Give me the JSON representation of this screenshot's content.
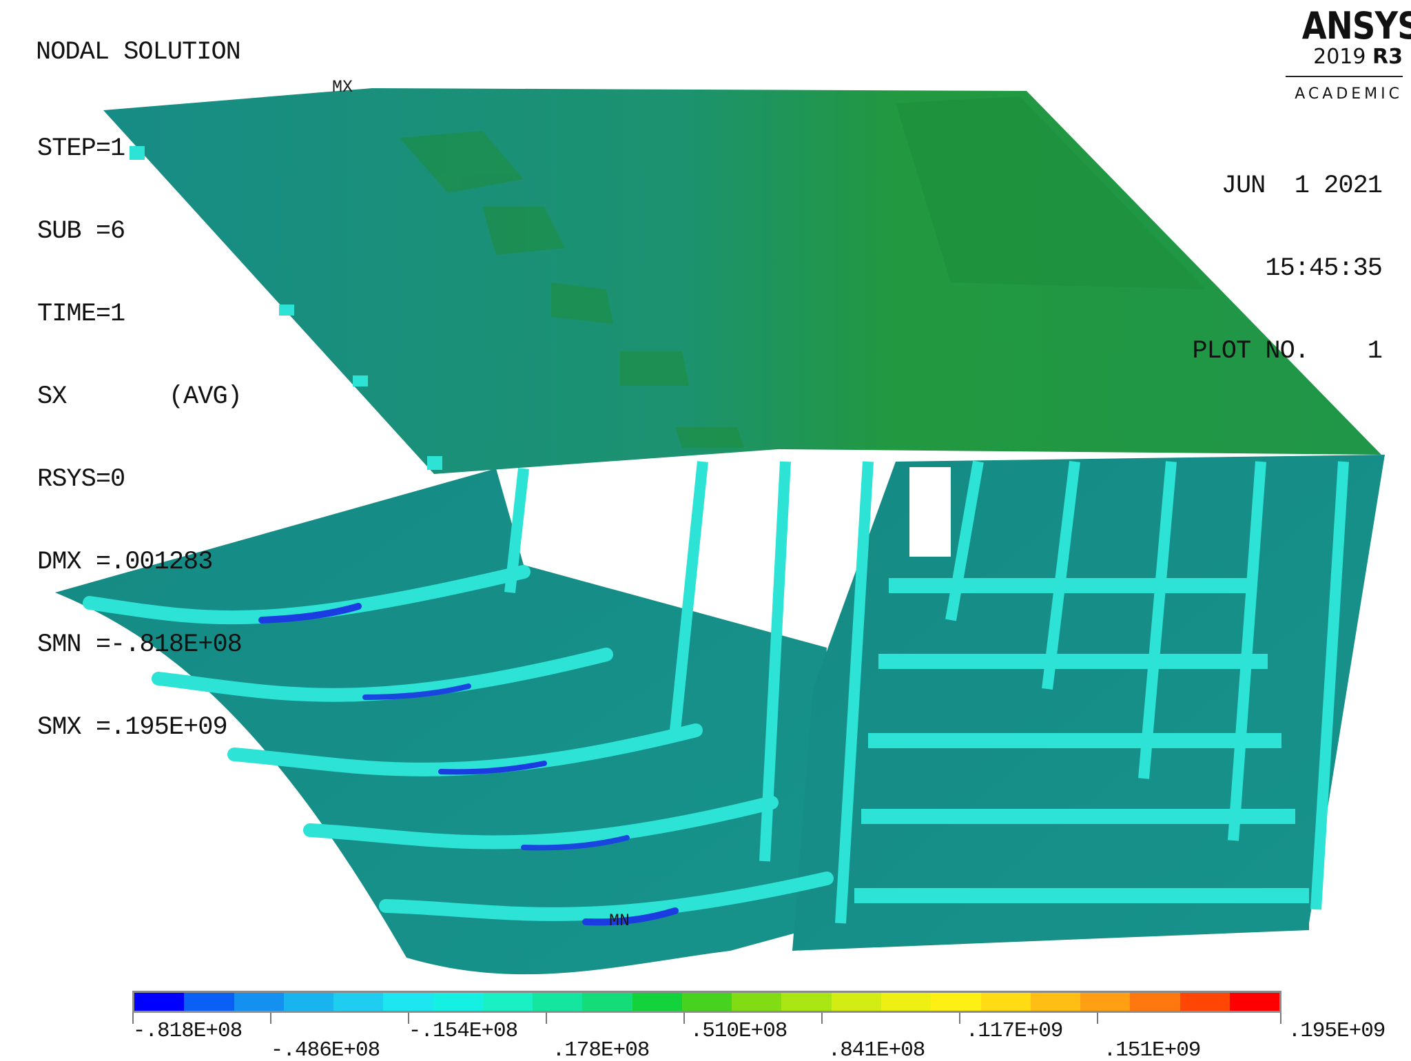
{
  "plot": {
    "title": "NODAL SOLUTION",
    "info_lines": [
      "STEP=1",
      "SUB =6",
      "TIME=1",
      "SX       (AVG)",
      "RSYS=0",
      "DMX =.001283",
      "SMN =-.818E+08",
      "SMX =.195E+09"
    ],
    "stamp_lines": [
      "JUN  1 2021",
      "15:45:35",
      "PLOT NO.    1"
    ],
    "markers": {
      "max": "MX",
      "min": "MN"
    }
  },
  "logo": {
    "name": "ANSYS",
    "version_year": "2019",
    "version_release": "R3",
    "edition": "ACADEMIC"
  },
  "legend": {
    "labels": [
      "-.818E+08",
      "-.486E+08",
      "-.154E+08",
      ".178E+08",
      ".510E+08",
      ".841E+08",
      ".117E+09",
      ".151E+09",
      ".195E+09"
    ],
    "colors": [
      "#0000ff",
      "#0a5ff5",
      "#1491f0",
      "#19b4f0",
      "#1ecdf0",
      "#1ee6f0",
      "#14f0e1",
      "#19f0c3",
      "#14e6a0",
      "#14dc78",
      "#14d23c",
      "#46d21e",
      "#82dc14",
      "#aae614",
      "#d2ec14",
      "#eef014",
      "#fff014",
      "#ffdc14",
      "#ffbe14",
      "#ffa014",
      "#ff780f",
      "#ff4605",
      "#ff0000"
    ]
  },
  "colors": {
    "plate": "#178f86",
    "plate_green": "#1f9a4a",
    "web": "#168f85",
    "flange": "#29e0d4",
    "low_stress": "#1a38e6"
  }
}
